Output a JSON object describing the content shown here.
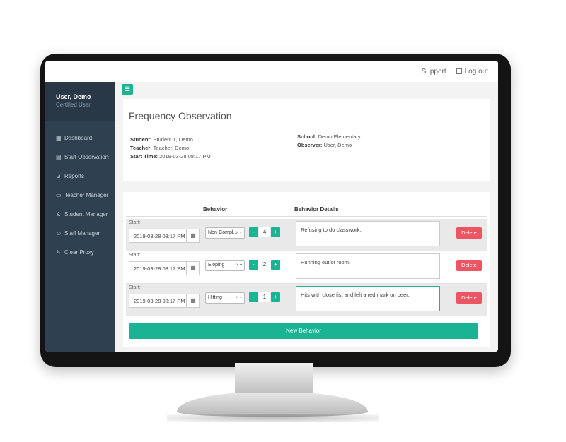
{
  "topnav": {
    "support": "Support",
    "logout": "Log out"
  },
  "sidebar": {
    "user_name": "User, Demo",
    "user_role": "Certified User",
    "items": [
      {
        "label": "Dashboard",
        "icon": "grid-icon"
      },
      {
        "label": "Start Observation",
        "icon": "clipboard-icon"
      },
      {
        "label": "Reports",
        "icon": "chart-icon"
      },
      {
        "label": "Teacher Manager",
        "icon": "teacher-icon"
      },
      {
        "label": "Student Manager",
        "icon": "student-icon"
      },
      {
        "label": "Staff Manager",
        "icon": "staff-icon"
      },
      {
        "label": "Clear Proxy",
        "icon": "broom-icon"
      }
    ]
  },
  "header": {
    "title": "Frequency Observation",
    "student_label": "Student:",
    "student": "Student 1, Demo",
    "teacher_label": "Teacher:",
    "teacher": "Teacher, Demo",
    "start_time_label": "Start Time:",
    "start_time": "2019-03-28 08:17 PM",
    "school_label": "School:",
    "school": "Demo Elementary",
    "observer_label": "Observer:",
    "observer": "User, Demo"
  },
  "table": {
    "col_behavior": "Behavior",
    "col_details": "Behavior Details",
    "start_label": "Start:",
    "rows": [
      {
        "start": "2019-03-28 08:17 PM",
        "behavior": "Non-Compl...",
        "count": "4",
        "details": "Refusing to do classwork.",
        "delete": "Delete"
      },
      {
        "start": "2019-03-28 08:17 PM",
        "behavior": "Eloping",
        "count": "2",
        "details": "Running out of room.",
        "delete": "Delete"
      },
      {
        "start": "2019-03-28 08:17 PM",
        "behavior": "Hitting",
        "count": "1",
        "details": "Hits with close fist and left a red mark on peer.",
        "delete": "Delete"
      }
    ],
    "minus": "-",
    "plus": "+",
    "new_behavior": "New Behavior"
  },
  "colors": {
    "accent": "#1ab394",
    "danger": "#ed5565",
    "sidebar": "#2f4050"
  }
}
